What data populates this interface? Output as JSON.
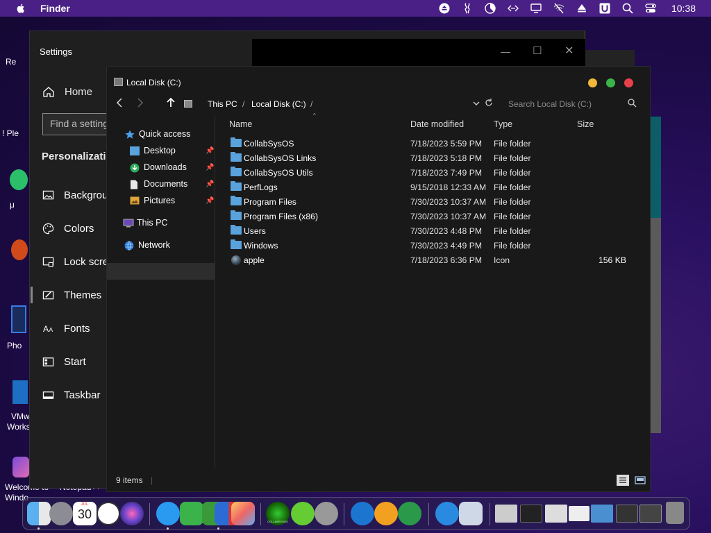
{
  "menubar": {
    "app_name": "Finder",
    "clock": "10:38",
    "icons": [
      "eject-icon",
      "collabsysos-icon",
      "pie-chart-icon",
      "code-icon",
      "monitor-icon",
      "wifi-off-icon",
      "up-arrow-icon",
      "u-icon",
      "search-icon",
      "control-center-icon"
    ]
  },
  "desktop": {
    "fragments": [
      "Re",
      "! Ple",
      "μ",
      "Pho",
      "VMw",
      "Works",
      "Welcome to",
      "Windo",
      "Notepad++"
    ]
  },
  "settings": {
    "title": "Settings",
    "home_label": "Home",
    "search_placeholder": "Find a setting",
    "section": "Personalization",
    "items": [
      "Background",
      "Colors",
      "Lock screen",
      "Themes",
      "Fonts",
      "Start",
      "Taskbar"
    ]
  },
  "explorer": {
    "title": "Local Disk (C:)",
    "breadcrumb": [
      "This PC",
      "Local Disk (C:)"
    ],
    "search_placeholder": "Search Local Disk (C:)",
    "sidebar": {
      "quick_access": "Quick access",
      "quick_items": [
        "Desktop",
        "Downloads",
        "Documents",
        "Pictures"
      ],
      "this_pc": "This PC",
      "network": "Network"
    },
    "columns": [
      "Name",
      "Date modified",
      "Type",
      "Size"
    ],
    "rows": [
      {
        "name": "CollabSysOS",
        "date": "7/18/2023 5:59 PM",
        "type": "File folder",
        "size": ""
      },
      {
        "name": "CollabSysOS Links",
        "date": "7/18/2023 5:18 PM",
        "type": "File folder",
        "size": ""
      },
      {
        "name": "CollabSysOS Utils",
        "date": "7/18/2023 7:49 PM",
        "type": "File folder",
        "size": ""
      },
      {
        "name": "PerfLogs",
        "date": "9/15/2018 12:33 AM",
        "type": "File folder",
        "size": ""
      },
      {
        "name": "Program Files",
        "date": "7/30/2023 10:37 AM",
        "type": "File folder",
        "size": ""
      },
      {
        "name": "Program Files (x86)",
        "date": "7/30/2023 10:37 AM",
        "type": "File folder",
        "size": ""
      },
      {
        "name": "Users",
        "date": "7/30/2023 4:48 PM",
        "type": "File folder",
        "size": ""
      },
      {
        "name": "Windows",
        "date": "7/30/2023 4:49 PM",
        "type": "File folder",
        "size": ""
      },
      {
        "name": "apple",
        "date": "7/18/2023 6:36 PM",
        "type": "Icon",
        "size": "156 KB"
      }
    ],
    "status": "9 items"
  },
  "dock": {
    "calendar_month": "JUL",
    "calendar_day": "30",
    "collab_label": "COLLABSYSOS",
    "items": [
      "finder-icon",
      "launchpad-icon",
      "calendar-icon",
      "clock-icon",
      "siri-icon",
      "safari-icon",
      "utorrent-icon",
      "folder-icon",
      "control-panel-icon",
      "photos-icon",
      "collabsysos-icon",
      "link-icon",
      "tools-icon",
      "www-icon",
      "download-icon",
      "dots-icon",
      "ie-icon",
      "box-icon",
      "window-thumb-1",
      "window-thumb-2",
      "window-thumb-3",
      "window-thumb-4",
      "window-thumb-5",
      "window-thumb-6",
      "window-thumb-7",
      "trash-icon"
    ]
  },
  "colors": {
    "menubar": "#4a1f86",
    "folder": "#5aa2dc",
    "close": "#e8404a",
    "minimize": "#f2b73a",
    "maximize": "#3ab54a"
  }
}
